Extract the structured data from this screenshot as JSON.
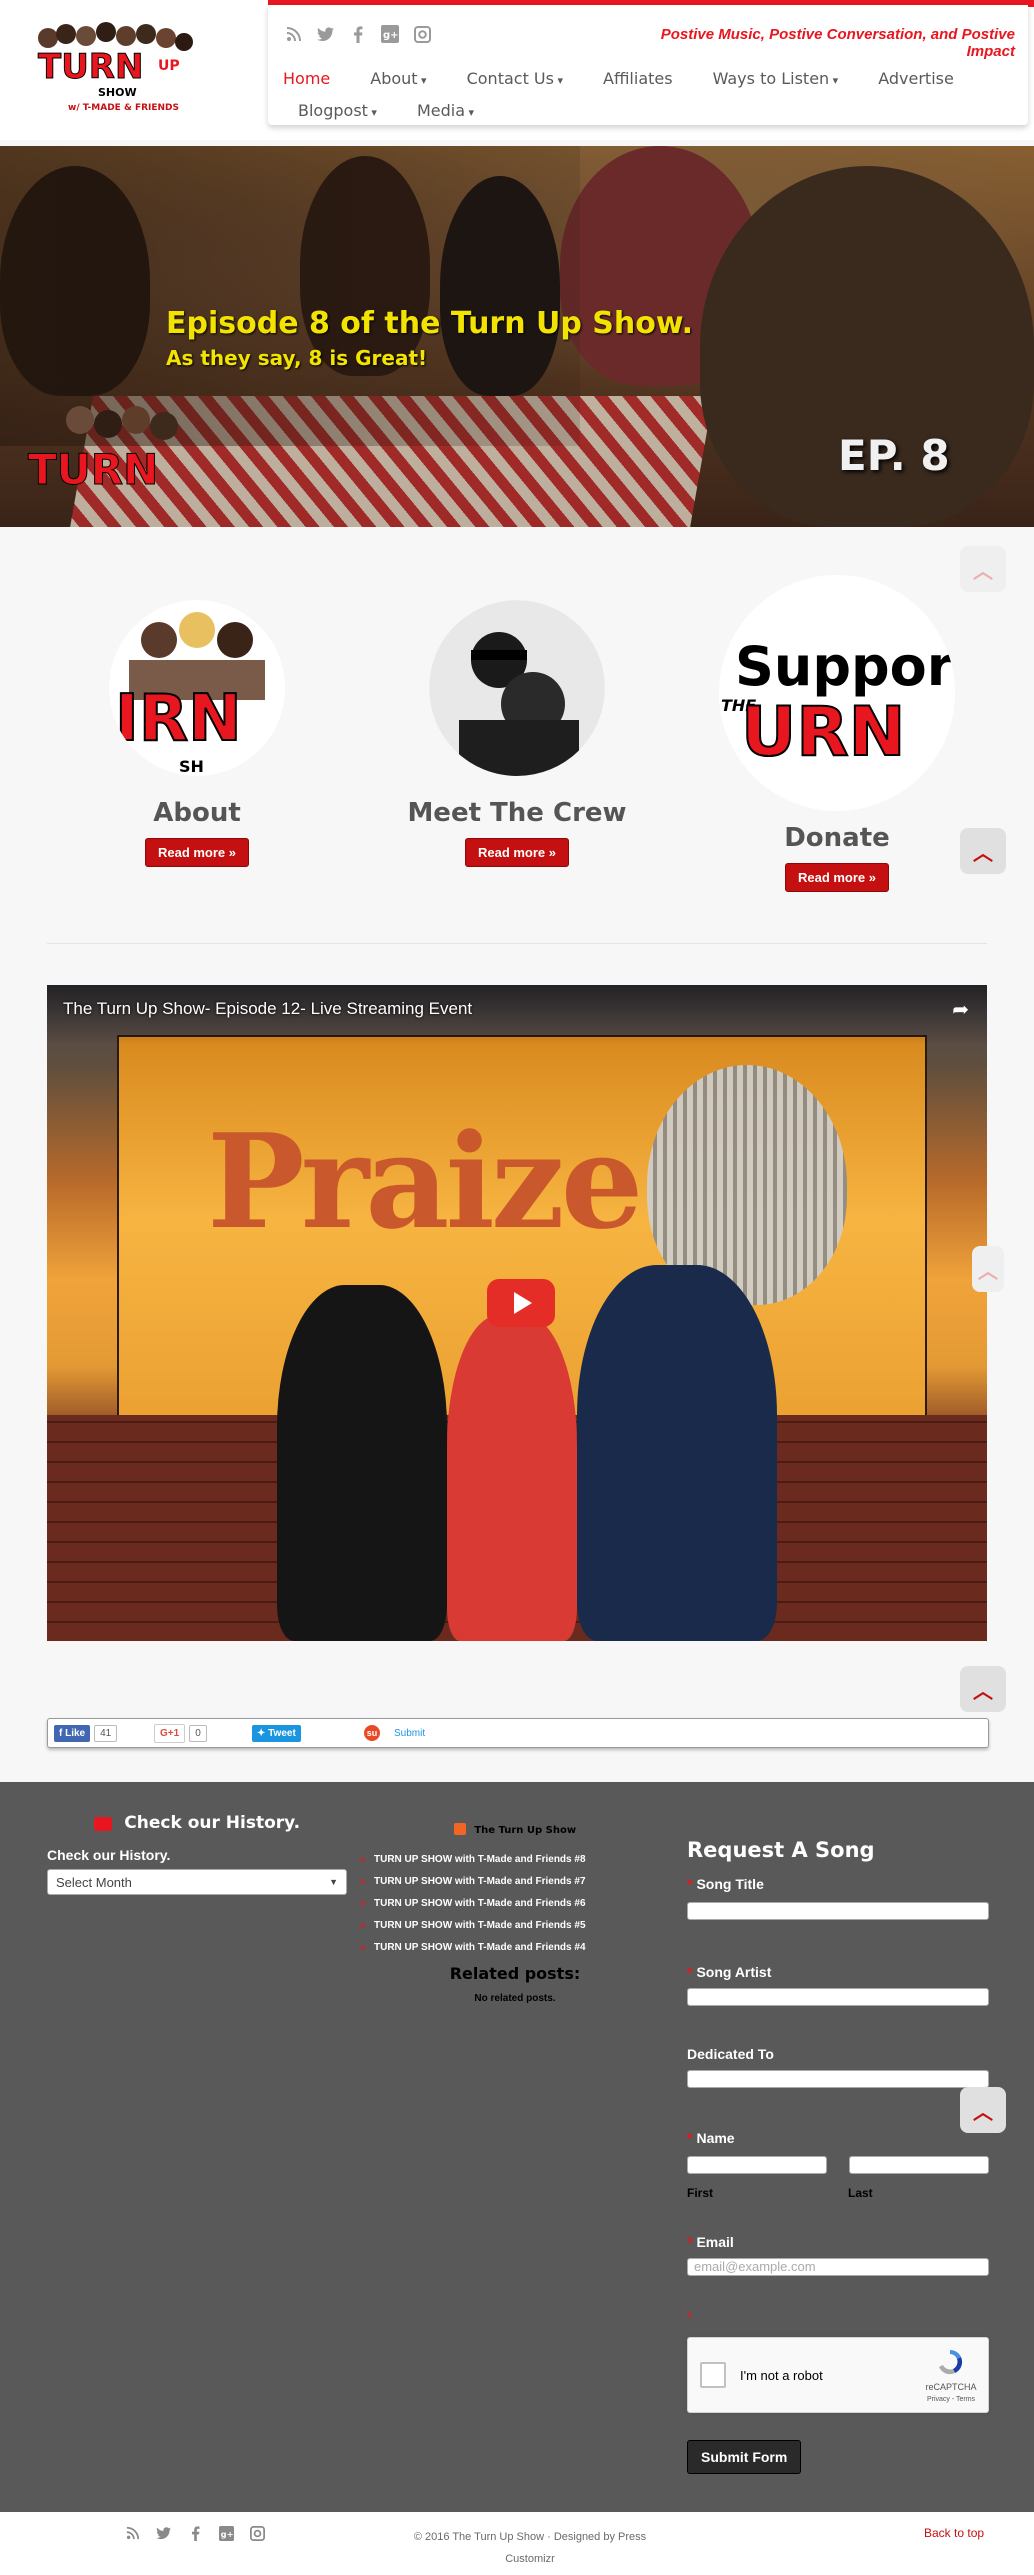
{
  "header": {
    "logo": {
      "word": "TURN",
      "word2": "UP",
      "show": "SHOW",
      "sub": "w/ T-MADE & FRIENDS"
    },
    "tagline": "Postive Music, Postive Conversation, and Postive Impact",
    "social_icons": [
      "rss-icon",
      "twitter-icon",
      "facebook-icon",
      "google-plus-icon",
      "instagram-icon"
    ],
    "nav": [
      {
        "label": "Home",
        "active": true,
        "caret": false
      },
      {
        "label": "About",
        "caret": true
      },
      {
        "label": "Contact Us",
        "caret": true
      },
      {
        "label": "Affiliates",
        "caret": false
      },
      {
        "label": "Ways to Listen",
        "caret": true
      },
      {
        "label": "Advertise",
        "caret": false
      },
      {
        "label": "Blogpost",
        "caret": true
      },
      {
        "label": "Media",
        "caret": true
      }
    ]
  },
  "hero": {
    "title": "Episode 8 of the Turn Up Show.",
    "subtitle": "As they say, 8 is Great!",
    "badge": "EP. 8"
  },
  "features": [
    {
      "title": "About",
      "button": "Read more »"
    },
    {
      "title": "Meet The Crew",
      "button": "Read more »"
    },
    {
      "title": "Donate",
      "button": "Read more »",
      "circle_text_1": "Support",
      "circle_text_2": "THE",
      "circle_text_3": "URN"
    }
  ],
  "video": {
    "title": "The Turn Up Show- Episode 12- Live Streaming Event",
    "banner_text": "Praize"
  },
  "share": {
    "like_label": "Like",
    "like_count": "41",
    "gplus_label": "G+1",
    "gplus_count": "0",
    "tweet_label": "Tweet",
    "submit_label": "Submit"
  },
  "footer": {
    "history": {
      "heading": "Check our History.",
      "label": "Check our History.",
      "select_value": "Select Month"
    },
    "posts": {
      "heading": "The Turn Up Show",
      "items": [
        "TURN UP SHOW with T-Made and Friends #8",
        "TURN UP SHOW with T-Made and Friends #7",
        "TURN UP SHOW with T-Made and Friends #6",
        "TURN UP SHOW with T-Made and Friends #5",
        "TURN UP SHOW with T-Made and Friends #4"
      ],
      "related_heading": "Related posts:",
      "related_none": "No related posts."
    },
    "form": {
      "heading": "Request A Song",
      "song_title": "Song Title",
      "song_artist": "Song Artist",
      "dedicated_to": "Dedicated To",
      "name": "Name",
      "first": "First",
      "last": "Last",
      "email": "Email",
      "email_placeholder": "email@example.com",
      "captcha_label": "I'm not a robot",
      "captcha_brand": "reCAPTCHA",
      "captcha_links": "Privacy - Terms",
      "submit": "Submit Form"
    }
  },
  "bottom": {
    "copyright_line1": "© 2016 The Turn Up Show · Designed by Press",
    "copyright_line2": "Customizr",
    "back_to_top": "Back to top"
  }
}
